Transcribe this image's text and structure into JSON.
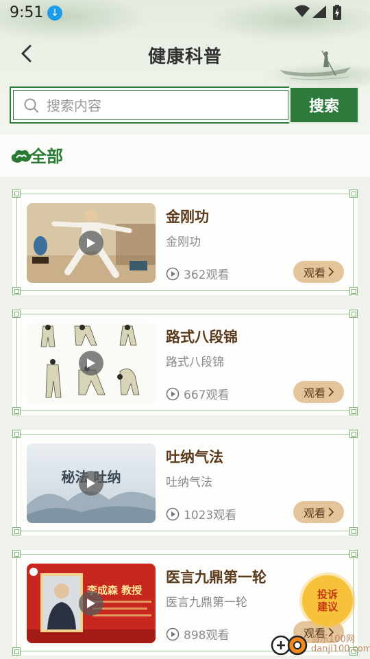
{
  "status_bar": {
    "time": "9:51"
  },
  "header": {
    "title": "健康科普"
  },
  "search": {
    "placeholder": "搜索内容",
    "button_label": "搜索"
  },
  "category": {
    "label": "全部"
  },
  "videos": [
    {
      "title": "金刚功",
      "subtitle": "金刚功",
      "views": "362观看",
      "watch_label": "观看"
    },
    {
      "title": "路式八段锦",
      "subtitle": "路式八段锦",
      "views": "667观看",
      "watch_label": "观看"
    },
    {
      "title": "吐纳气法",
      "subtitle": "吐纳气法",
      "views": "1023观看",
      "watch_label": "观看",
      "thumb_text": "秘法 吐纳"
    },
    {
      "title": "医言九鼎第一轮",
      "subtitle": "医言九鼎第一轮",
      "views": "898观看",
      "watch_label": "观看",
      "thumb_text": "李成森 教授"
    }
  ],
  "complaint": {
    "label": "投诉建议"
  },
  "watermark": {
    "line1": "当乐100网",
    "line2": "danji100.com"
  },
  "colors": {
    "brand_green": "#2d7a3c",
    "title_brown": "#5a3a1c",
    "watch_button": "#e4c49b",
    "complaint_yellow": "#f7c13a"
  }
}
